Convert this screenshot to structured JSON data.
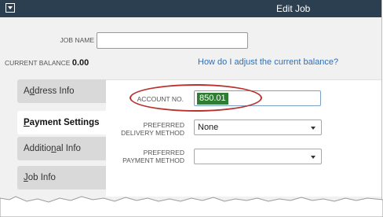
{
  "window": {
    "title": "Edit Job"
  },
  "header": {
    "job_name_label": "JOB NAME",
    "job_name_value": "",
    "current_balance_label": "CURRENT BALANCE",
    "current_balance_value": "0.00",
    "adjust_link": "How do I adjust the current balance?"
  },
  "tabs": [
    {
      "label": "Address Info",
      "mnemonic": "d"
    },
    {
      "label": "Payment Settings",
      "mnemonic": "P"
    },
    {
      "label": "Additional Info",
      "mnemonic": "n"
    },
    {
      "label": "Job Info",
      "mnemonic": "J"
    }
  ],
  "payment": {
    "account_no_label": "ACCOUNT NO.",
    "account_no_value": "850.01",
    "delivery_label_1": "PREFERRED",
    "delivery_label_2": "DELIVERY METHOD",
    "delivery_value": "None",
    "payment_label_1": "PREFERRED",
    "payment_label_2": "PAYMENT METHOD",
    "payment_value": ""
  },
  "colors": {
    "titlebar": "#2c3f50",
    "link": "#2d6fb8",
    "selection": "#2f7d32",
    "annotation": "#b8322e"
  },
  "icons": {
    "system_menu": "dropdown-box-icon"
  }
}
